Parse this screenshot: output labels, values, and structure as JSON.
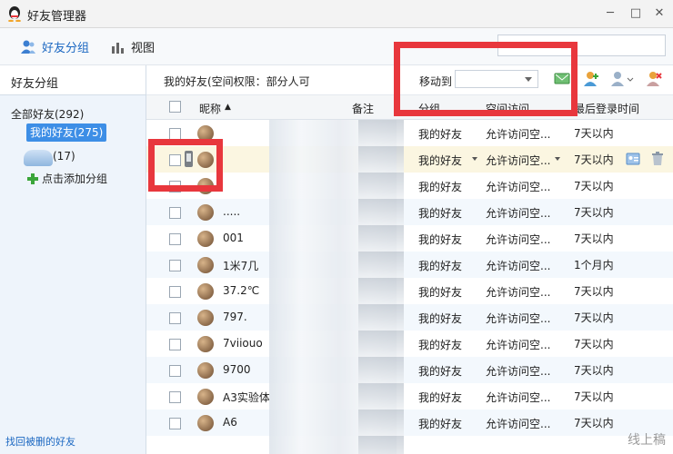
{
  "window": {
    "title": "好友管理器",
    "minimize": "─",
    "maximize": "□",
    "close": "✕"
  },
  "toolbar": {
    "friends_group": "好友分组",
    "view": "视图"
  },
  "sidebar": {
    "title": "好友分组",
    "all_friends": "全部好友(292)",
    "group_active": "我的好友(275)",
    "group_second_count": "(17)",
    "add_group": "点击添加分组",
    "recover": "找回被删的好友"
  },
  "infobar": {
    "text": "我的好友(空间权限：部分人可",
    "move_to": "移动到",
    "move_select_value": ""
  },
  "table": {
    "headers": {
      "nickname": "昵称",
      "remark": "备注",
      "group": "分组",
      "space": "空间访问",
      "last_login": "最后登录时间"
    },
    "rows": [
      {
        "nick": "",
        "group": "我的好友",
        "perm": "允许访问空...",
        "login": "7天以内"
      },
      {
        "nick": "",
        "group": "我的好友",
        "perm": "允许访问空...",
        "login": "7天以内"
      },
      {
        "nick": "",
        "group": "我的好友",
        "perm": "允许访问空...",
        "login": "7天以内"
      },
      {
        "nick": ".....",
        "group": "我的好友",
        "perm": "允许访问空...",
        "login": "7天以内"
      },
      {
        "nick": "001",
        "group": "我的好友",
        "perm": "允许访问空...",
        "login": "7天以内"
      },
      {
        "nick": "1米7几",
        "group": "我的好友",
        "perm": "允许访问空...",
        "login": "1个月内"
      },
      {
        "nick": "37.2℃",
        "group": "我的好友",
        "perm": "允许访问空...",
        "login": "7天以内"
      },
      {
        "nick": "797.",
        "group": "我的好友",
        "perm": "允许访问空...",
        "login": "7天以内"
      },
      {
        "nick": "7viiouo",
        "group": "我的好友",
        "perm": "允许访问空...",
        "login": "7天以内"
      },
      {
        "nick": "9700",
        "group": "我的好友",
        "perm": "允许访问空...",
        "login": "7天以内"
      },
      {
        "nick": "A3实验体",
        "group": "我的好友",
        "perm": "允许访问空...",
        "login": "7天以内"
      },
      {
        "nick": "A6",
        "group": "我的好友",
        "perm": "允许访问空...",
        "login": "7天以内"
      }
    ]
  },
  "watermark": "线上稿",
  "colors": {
    "accent": "#1c68c2",
    "highlight": "#e8373d",
    "selected_group": "#3d8ee6"
  }
}
